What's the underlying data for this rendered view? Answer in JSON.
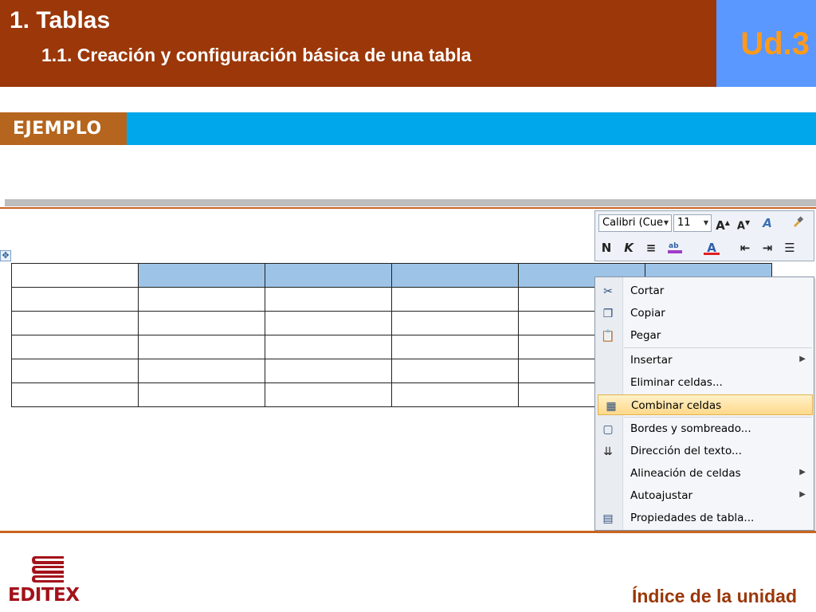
{
  "header": {
    "title": "1. Tablas",
    "subtitle": "1.1. Creación y configuración básica de una tabla",
    "unit": "Ud.3",
    "colors": {
      "bar": "#9b3708",
      "unit_box": "#5a97ff",
      "unit_text": "#ff9a1a"
    }
  },
  "banner": {
    "label": "EJEMPLO",
    "colors": {
      "bar": "#00a7ea",
      "label_bg": "#b5651d"
    }
  },
  "mini_toolbar": {
    "font_name": "Calibri (Cue",
    "font_size": "11",
    "row1_icons": [
      "grow-font-icon",
      "shrink-font-icon",
      "styles-icon",
      "format-painter-icon"
    ],
    "row2_icons": [
      "bold-icon",
      "italic-icon",
      "center-align-icon",
      "highlight-icon",
      "font-color-icon",
      "decrease-indent-icon",
      "increase-indent-icon",
      "bullets-icon"
    ],
    "bold_glyph": "N",
    "italic_glyph": "K"
  },
  "context_menu": {
    "items": [
      {
        "label": "Cortar",
        "icon": "scissors-icon",
        "submenu": false
      },
      {
        "label": "Copiar",
        "icon": "copy-icon",
        "submenu": false
      },
      {
        "label": "Pegar",
        "icon": "paste-icon",
        "submenu": false
      },
      {
        "label": "Insertar",
        "icon": "",
        "submenu": true
      },
      {
        "label": "Eliminar celdas...",
        "icon": "",
        "submenu": false
      },
      {
        "label": "Combinar celdas",
        "icon": "merge-cells-icon",
        "submenu": false,
        "highlighted": true
      },
      {
        "label": "Bordes y sombreado...",
        "icon": "borders-icon",
        "submenu": false
      },
      {
        "label": "Dirección del texto...",
        "icon": "text-direction-icon",
        "submenu": false
      },
      {
        "label": "Alineación de celdas",
        "icon": "",
        "submenu": true
      },
      {
        "label": "Autoajustar",
        "icon": "",
        "submenu": true
      },
      {
        "label": "Propiedades de tabla...",
        "icon": "table-properties-icon",
        "submenu": false
      }
    ]
  },
  "document_table": {
    "rows": 6,
    "columns": 6,
    "selected_cells_row1": [
      2,
      3,
      4,
      5,
      6
    ],
    "selection_color": "#9dc3e6"
  },
  "footer": {
    "logo_text": "EDITEX",
    "index_link": "Índice de la unidad",
    "colors": {
      "logo": "#a3121a",
      "link": "#9b3708"
    }
  }
}
